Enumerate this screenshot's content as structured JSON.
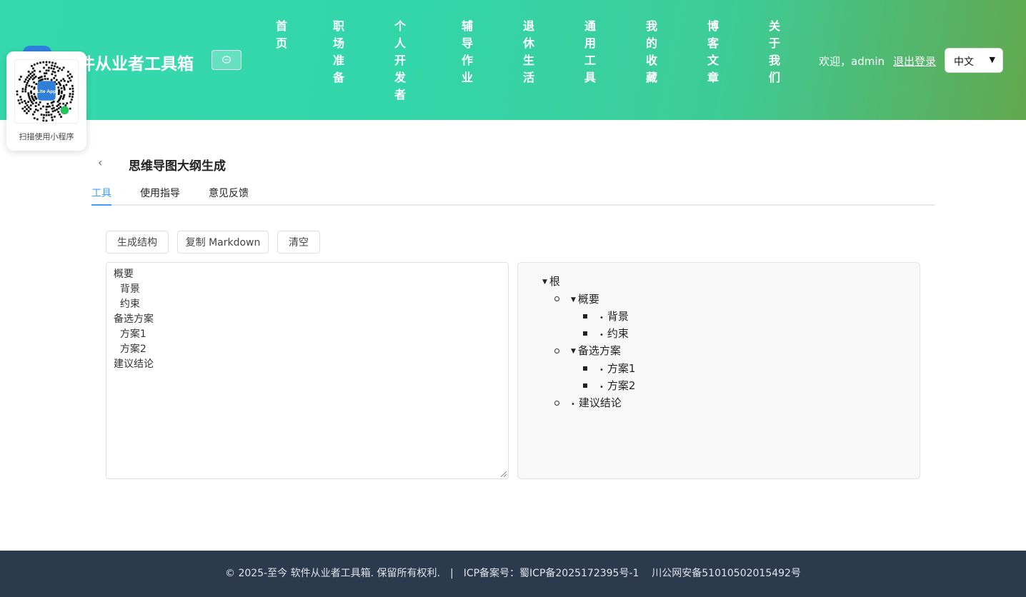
{
  "header": {
    "site_title": "件从业者工具箱",
    "nav": [
      "首页",
      "职场准备",
      "个人开发者",
      "辅导作业",
      "退休生活",
      "通用工具",
      "我的收藏",
      "博客文章",
      "关于我们"
    ],
    "welcome": "欢迎，admin",
    "logout": "退出登录",
    "language": "中文"
  },
  "qr": {
    "caption": "扫描使用小程序",
    "logo_text": "Lite App"
  },
  "page": {
    "title": "思维导图大纲生成",
    "tabs": [
      "工具",
      "使用指导",
      "意见反馈"
    ]
  },
  "toolbar": {
    "generate": "生成结构",
    "copy_markdown": "复制 Markdown",
    "clear": "清空"
  },
  "editor": {
    "lines": [
      "概要",
      "  背景",
      "  约束",
      "备选方案",
      "  方案1",
      "  方案2",
      "建议结论"
    ]
  },
  "preview": {
    "root": "根",
    "nodes": [
      "概要",
      "背景",
      "约束",
      "备选方案",
      "方案1",
      "方案2",
      "建议结论"
    ]
  },
  "footer": {
    "copyright": "© 2025-至今 软件从业者工具箱. 保留所有权利.",
    "separator": "|",
    "icp": "ICP备案号：蜀ICP备2025172395号-1",
    "police": "川公网安备51010502015492号"
  },
  "colors": {
    "accent": "#409eff",
    "header_start": "#34d9ad",
    "header_end": "#62a84e",
    "footer": "#2c3a4e"
  }
}
